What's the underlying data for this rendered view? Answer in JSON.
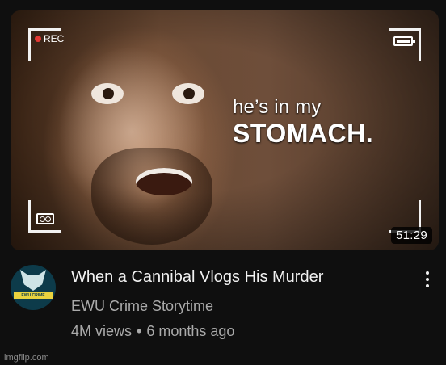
{
  "thumbnail": {
    "caption_line1": "he’s in my",
    "caption_line2": "STOMACH.",
    "rec_label": "REC",
    "duration": "51:29",
    "icons": [
      "rec-dot-icon",
      "battery-icon",
      "cassette-tape-icon"
    ]
  },
  "video": {
    "title": "When a Cannibal Vlogs His Murder",
    "channel": "EWU Crime Storytime",
    "views": "4M views",
    "separator": "•",
    "age": "6 months ago"
  },
  "avatar": {
    "icon": "wolf-logo-icon",
    "logo_text": "EWU CRIME STORYTIME"
  },
  "menu": {
    "icon": "more-vertical-icon"
  },
  "watermark": "imgflip.com",
  "colors": {
    "background": "#0f0f0f",
    "title": "#f1f1f1",
    "secondary_text": "#aaaaaa",
    "rec_dot": "#e53935"
  }
}
